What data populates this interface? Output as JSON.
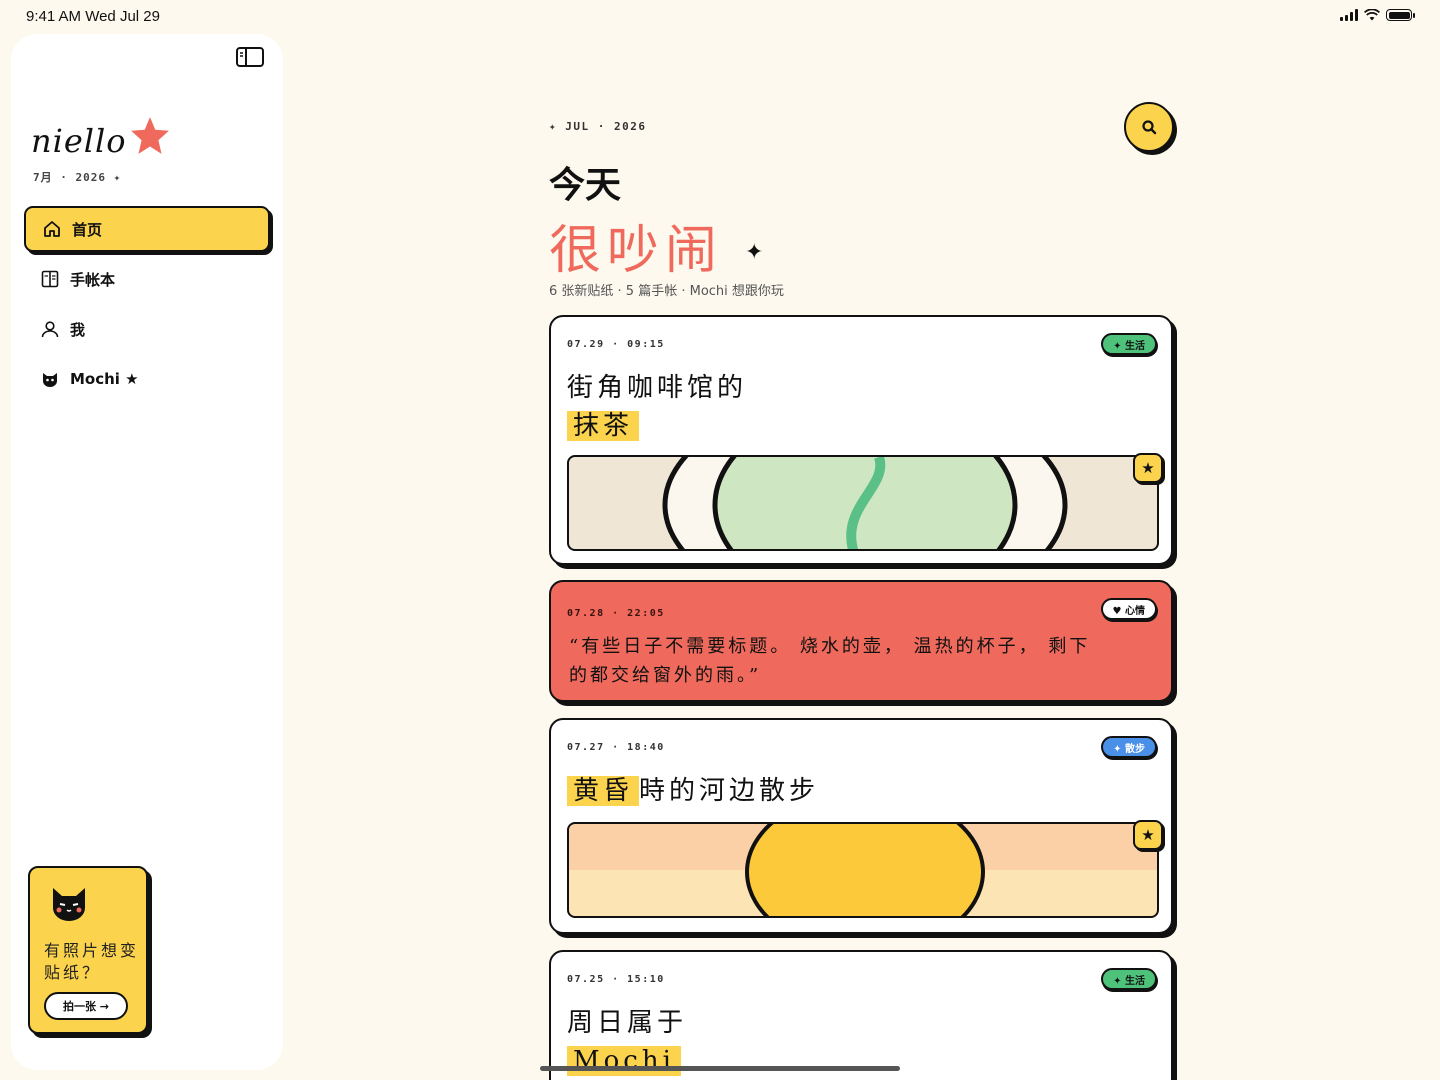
{
  "status_bar": {
    "time": "9:41 AM   Wed Jul 29"
  },
  "sidebar": {
    "logo_text": "niello",
    "logo_sub": "7月 · 2026 ✦",
    "nav": [
      {
        "label": "首页",
        "icon": "home-icon",
        "active": true
      },
      {
        "label": "手帐本",
        "icon": "notebook-icon",
        "active": false
      },
      {
        "label": "我",
        "icon": "user-icon",
        "active": false
      },
      {
        "label": "Mochi ★",
        "icon": "cat-icon",
        "active": false
      }
    ],
    "promo": {
      "text": "有照片想变贴纸？",
      "button_label": "拍一张 →"
    }
  },
  "header": {
    "date_line": "✦ JUL · 2026",
    "title": "今天",
    "mood": "很吵闹",
    "summary": "6 张新贴纸 · 5 篇手帐 · Mochi 想跟你玩"
  },
  "entries": [
    {
      "stamp": "07.29 · 09:15",
      "tag": "✦ 生活",
      "title_line1": "街角咖啡馆的",
      "title_highlight": "抹茶"
    },
    {
      "stamp": "07.28 · 22:05",
      "tag": "♥ 心情",
      "quote": "“有些日子不需要标题。 烧水的壶， 温热的杯子， 剩下的都交给窗外的雨。”"
    },
    {
      "stamp": "07.27 · 18:40",
      "tag": "✦ 散步",
      "title_highlight": "黄昏",
      "title_rest": "時的河边散步"
    },
    {
      "stamp": "07.25 · 15:10",
      "tag": "✦ 生活",
      "title_line1": "周日属于",
      "title_highlight": "Mochi"
    }
  ],
  "colors": {
    "accent_yellow": "#fcd34d",
    "accent_red": "#ef6a5c",
    "tag_green": "#4ec27a",
    "tag_blue": "#4a8fe8",
    "background": "#fdf9ee"
  }
}
